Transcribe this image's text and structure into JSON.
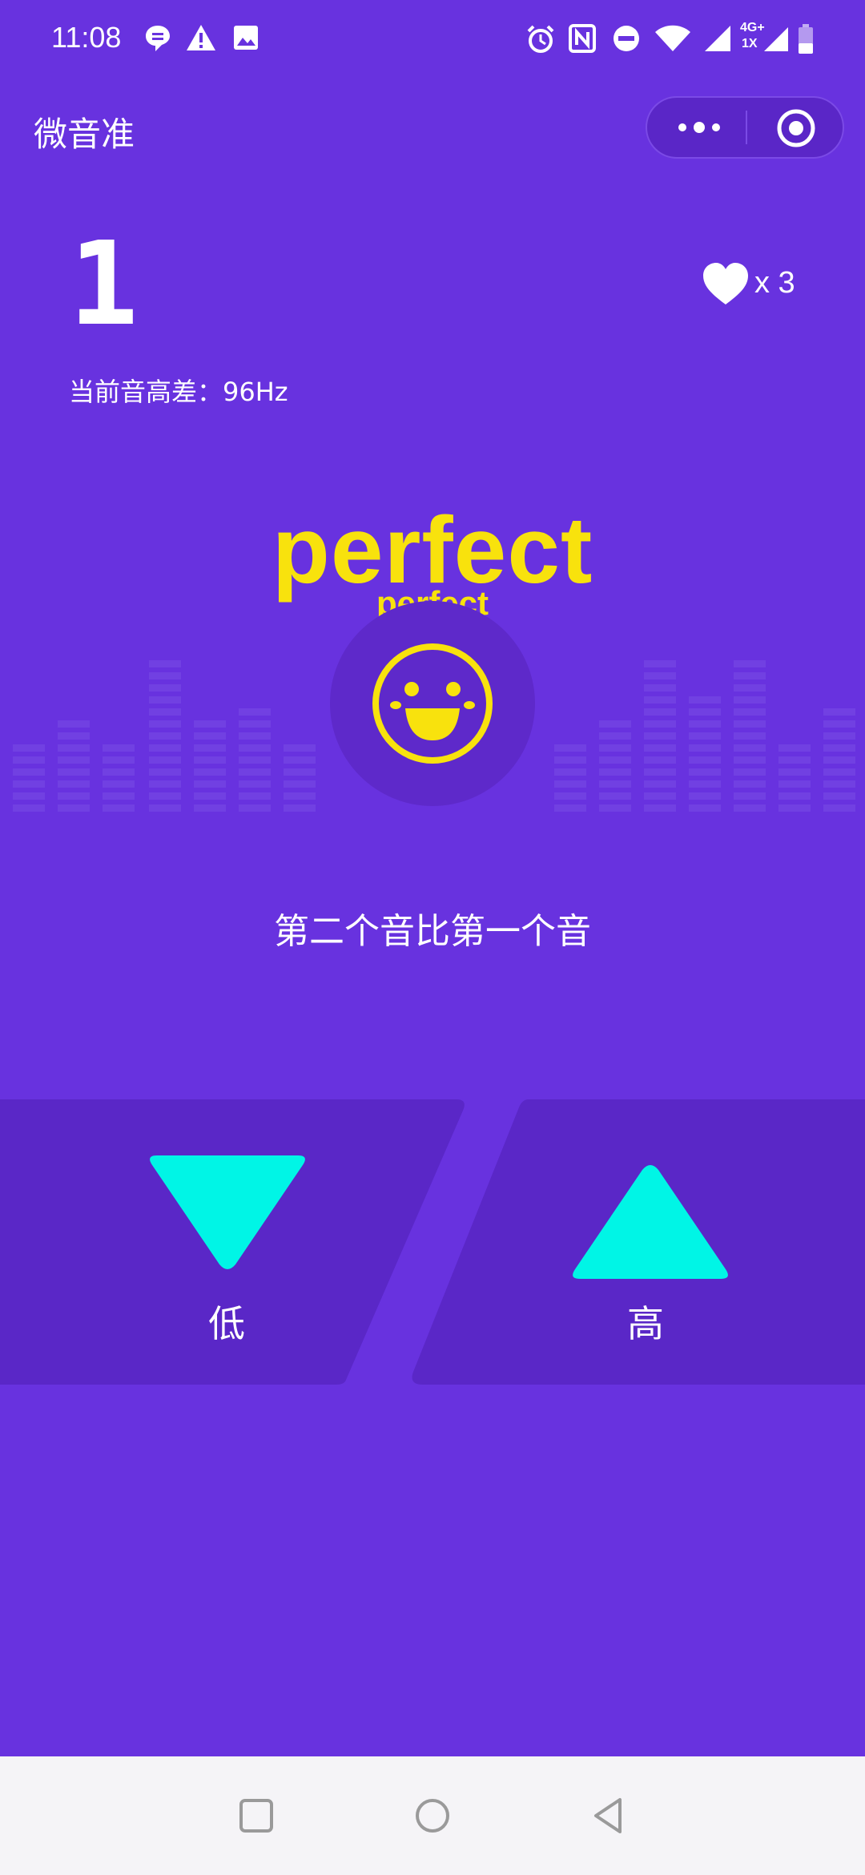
{
  "status_bar": {
    "time": "11:08",
    "icons": [
      "chat-bubble-icon",
      "warning-icon",
      "image-icon",
      "alarm-icon",
      "nfc-icon",
      "dnd-icon",
      "wifi-icon",
      "signal-icon",
      "signal-4g-icon",
      "battery-icon"
    ],
    "network_label_top": "4G+",
    "network_label_bottom": "1X"
  },
  "top_bar": {
    "title": "微音准",
    "more_icon": "more-dots-icon",
    "close_icon": "target-icon"
  },
  "game": {
    "score": "1",
    "pitch_diff_label": "当前音高差：96Hz",
    "lives_icon": "heart-icon",
    "lives_count": "x 3",
    "feedback_big": "perfect",
    "feedback_small": "perfect",
    "feedback_icon": "smiley-face-icon",
    "question": "第二个音比第一个音"
  },
  "buttons": {
    "low_label": "低",
    "high_label": "高",
    "low_icon": "triangle-down-icon",
    "high_icon": "triangle-up-icon"
  },
  "colors": {
    "background": "#6832df",
    "panel": "#5a27c7",
    "accent_yellow": "#f8e20d",
    "accent_cyan": "#00f5e6"
  },
  "nav_bar": {
    "icons": [
      "square-icon",
      "circle-icon",
      "back-triangle-icon"
    ]
  }
}
